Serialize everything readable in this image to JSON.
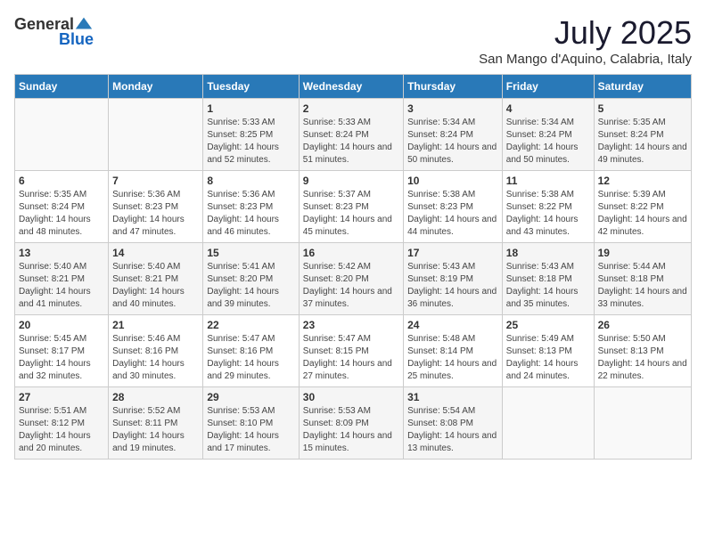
{
  "header": {
    "logo_general": "General",
    "logo_blue": "Blue",
    "month_title": "July 2025",
    "location": "San Mango d'Aquino, Calabria, Italy"
  },
  "days_of_week": [
    "Sunday",
    "Monday",
    "Tuesday",
    "Wednesday",
    "Thursday",
    "Friday",
    "Saturday"
  ],
  "weeks": [
    [
      {
        "day": "",
        "sunrise": "",
        "sunset": "",
        "daylight": ""
      },
      {
        "day": "",
        "sunrise": "",
        "sunset": "",
        "daylight": ""
      },
      {
        "day": "1",
        "sunrise": "Sunrise: 5:33 AM",
        "sunset": "Sunset: 8:25 PM",
        "daylight": "Daylight: 14 hours and 52 minutes."
      },
      {
        "day": "2",
        "sunrise": "Sunrise: 5:33 AM",
        "sunset": "Sunset: 8:24 PM",
        "daylight": "Daylight: 14 hours and 51 minutes."
      },
      {
        "day": "3",
        "sunrise": "Sunrise: 5:34 AM",
        "sunset": "Sunset: 8:24 PM",
        "daylight": "Daylight: 14 hours and 50 minutes."
      },
      {
        "day": "4",
        "sunrise": "Sunrise: 5:34 AM",
        "sunset": "Sunset: 8:24 PM",
        "daylight": "Daylight: 14 hours and 50 minutes."
      },
      {
        "day": "5",
        "sunrise": "Sunrise: 5:35 AM",
        "sunset": "Sunset: 8:24 PM",
        "daylight": "Daylight: 14 hours and 49 minutes."
      }
    ],
    [
      {
        "day": "6",
        "sunrise": "Sunrise: 5:35 AM",
        "sunset": "Sunset: 8:24 PM",
        "daylight": "Daylight: 14 hours and 48 minutes."
      },
      {
        "day": "7",
        "sunrise": "Sunrise: 5:36 AM",
        "sunset": "Sunset: 8:23 PM",
        "daylight": "Daylight: 14 hours and 47 minutes."
      },
      {
        "day": "8",
        "sunrise": "Sunrise: 5:36 AM",
        "sunset": "Sunset: 8:23 PM",
        "daylight": "Daylight: 14 hours and 46 minutes."
      },
      {
        "day": "9",
        "sunrise": "Sunrise: 5:37 AM",
        "sunset": "Sunset: 8:23 PM",
        "daylight": "Daylight: 14 hours and 45 minutes."
      },
      {
        "day": "10",
        "sunrise": "Sunrise: 5:38 AM",
        "sunset": "Sunset: 8:23 PM",
        "daylight": "Daylight: 14 hours and 44 minutes."
      },
      {
        "day": "11",
        "sunrise": "Sunrise: 5:38 AM",
        "sunset": "Sunset: 8:22 PM",
        "daylight": "Daylight: 14 hours and 43 minutes."
      },
      {
        "day": "12",
        "sunrise": "Sunrise: 5:39 AM",
        "sunset": "Sunset: 8:22 PM",
        "daylight": "Daylight: 14 hours and 42 minutes."
      }
    ],
    [
      {
        "day": "13",
        "sunrise": "Sunrise: 5:40 AM",
        "sunset": "Sunset: 8:21 PM",
        "daylight": "Daylight: 14 hours and 41 minutes."
      },
      {
        "day": "14",
        "sunrise": "Sunrise: 5:40 AM",
        "sunset": "Sunset: 8:21 PM",
        "daylight": "Daylight: 14 hours and 40 minutes."
      },
      {
        "day": "15",
        "sunrise": "Sunrise: 5:41 AM",
        "sunset": "Sunset: 8:20 PM",
        "daylight": "Daylight: 14 hours and 39 minutes."
      },
      {
        "day": "16",
        "sunrise": "Sunrise: 5:42 AM",
        "sunset": "Sunset: 8:20 PM",
        "daylight": "Daylight: 14 hours and 37 minutes."
      },
      {
        "day": "17",
        "sunrise": "Sunrise: 5:43 AM",
        "sunset": "Sunset: 8:19 PM",
        "daylight": "Daylight: 14 hours and 36 minutes."
      },
      {
        "day": "18",
        "sunrise": "Sunrise: 5:43 AM",
        "sunset": "Sunset: 8:18 PM",
        "daylight": "Daylight: 14 hours and 35 minutes."
      },
      {
        "day": "19",
        "sunrise": "Sunrise: 5:44 AM",
        "sunset": "Sunset: 8:18 PM",
        "daylight": "Daylight: 14 hours and 33 minutes."
      }
    ],
    [
      {
        "day": "20",
        "sunrise": "Sunrise: 5:45 AM",
        "sunset": "Sunset: 8:17 PM",
        "daylight": "Daylight: 14 hours and 32 minutes."
      },
      {
        "day": "21",
        "sunrise": "Sunrise: 5:46 AM",
        "sunset": "Sunset: 8:16 PM",
        "daylight": "Daylight: 14 hours and 30 minutes."
      },
      {
        "day": "22",
        "sunrise": "Sunrise: 5:47 AM",
        "sunset": "Sunset: 8:16 PM",
        "daylight": "Daylight: 14 hours and 29 minutes."
      },
      {
        "day": "23",
        "sunrise": "Sunrise: 5:47 AM",
        "sunset": "Sunset: 8:15 PM",
        "daylight": "Daylight: 14 hours and 27 minutes."
      },
      {
        "day": "24",
        "sunrise": "Sunrise: 5:48 AM",
        "sunset": "Sunset: 8:14 PM",
        "daylight": "Daylight: 14 hours and 25 minutes."
      },
      {
        "day": "25",
        "sunrise": "Sunrise: 5:49 AM",
        "sunset": "Sunset: 8:13 PM",
        "daylight": "Daylight: 14 hours and 24 minutes."
      },
      {
        "day": "26",
        "sunrise": "Sunrise: 5:50 AM",
        "sunset": "Sunset: 8:13 PM",
        "daylight": "Daylight: 14 hours and 22 minutes."
      }
    ],
    [
      {
        "day": "27",
        "sunrise": "Sunrise: 5:51 AM",
        "sunset": "Sunset: 8:12 PM",
        "daylight": "Daylight: 14 hours and 20 minutes."
      },
      {
        "day": "28",
        "sunrise": "Sunrise: 5:52 AM",
        "sunset": "Sunset: 8:11 PM",
        "daylight": "Daylight: 14 hours and 19 minutes."
      },
      {
        "day": "29",
        "sunrise": "Sunrise: 5:53 AM",
        "sunset": "Sunset: 8:10 PM",
        "daylight": "Daylight: 14 hours and 17 minutes."
      },
      {
        "day": "30",
        "sunrise": "Sunrise: 5:53 AM",
        "sunset": "Sunset: 8:09 PM",
        "daylight": "Daylight: 14 hours and 15 minutes."
      },
      {
        "day": "31",
        "sunrise": "Sunrise: 5:54 AM",
        "sunset": "Sunset: 8:08 PM",
        "daylight": "Daylight: 14 hours and 13 minutes."
      },
      {
        "day": "",
        "sunrise": "",
        "sunset": "",
        "daylight": ""
      },
      {
        "day": "",
        "sunrise": "",
        "sunset": "",
        "daylight": ""
      }
    ]
  ]
}
